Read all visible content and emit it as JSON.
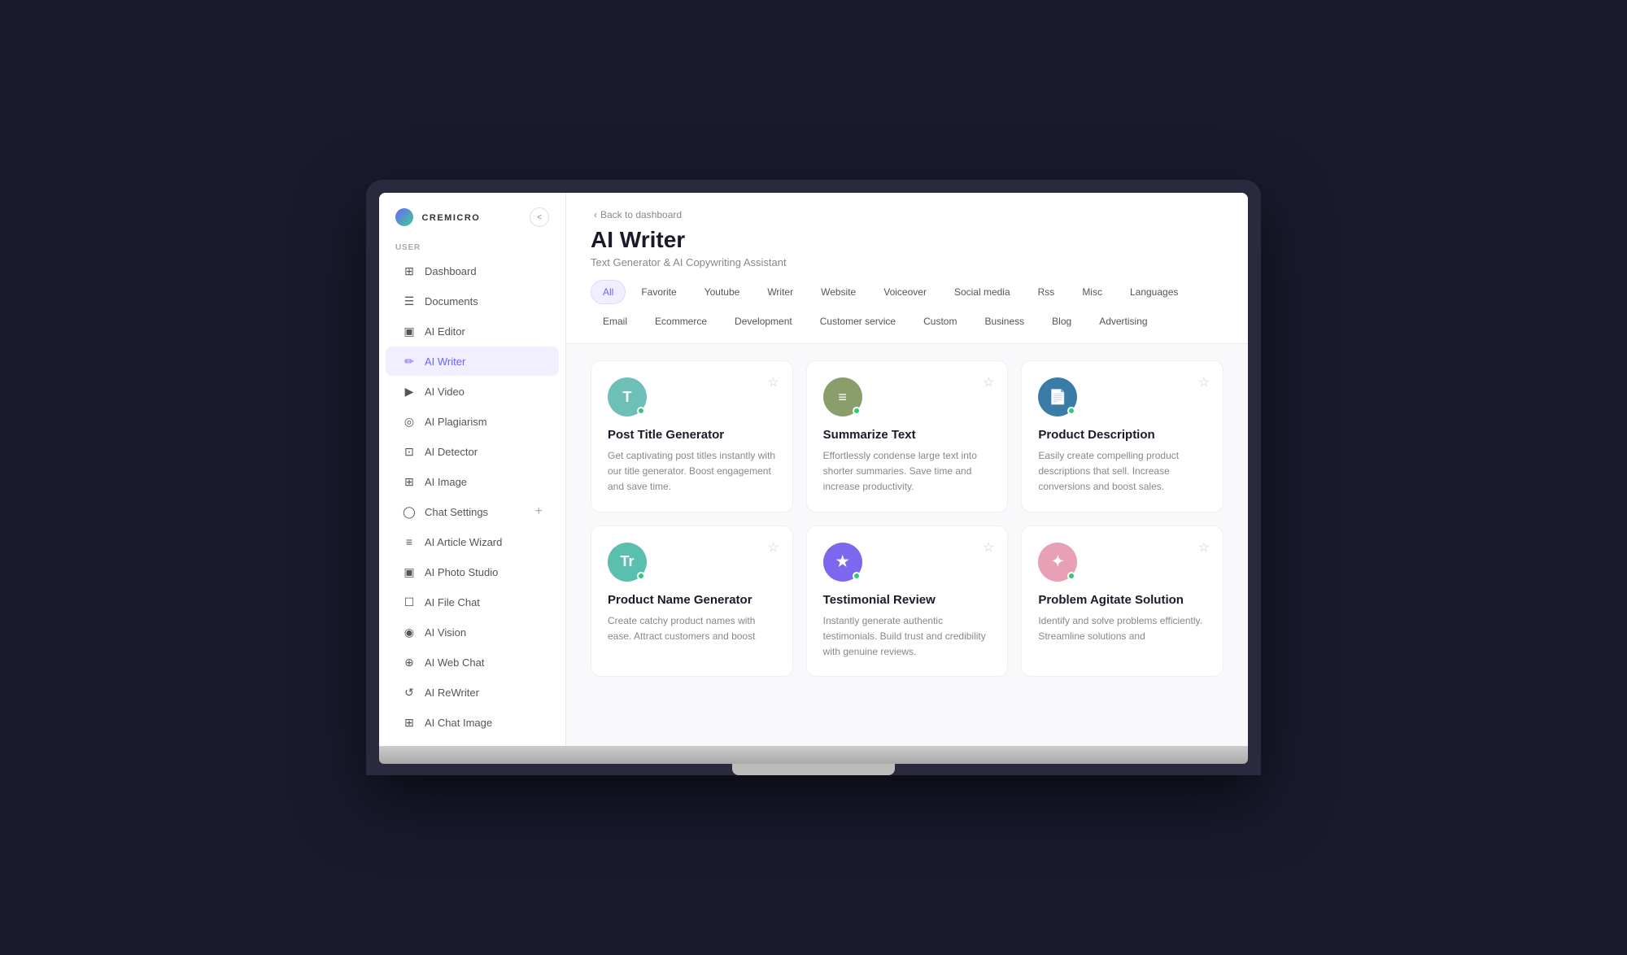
{
  "logo": {
    "text": "CREMICRO",
    "collapse_label": "<"
  },
  "sidebar": {
    "section_label": "USER",
    "items": [
      {
        "id": "dashboard",
        "label": "Dashboard",
        "icon": "⊞",
        "active": false
      },
      {
        "id": "documents",
        "label": "Documents",
        "icon": "☰",
        "active": false
      },
      {
        "id": "ai-editor",
        "label": "AI Editor",
        "icon": "▣",
        "active": false
      },
      {
        "id": "ai-writer",
        "label": "AI Writer",
        "icon": "✏",
        "active": true
      },
      {
        "id": "ai-video",
        "label": "AI Video",
        "icon": "▶",
        "active": false
      },
      {
        "id": "ai-plagiarism",
        "label": "AI Plagiarism",
        "icon": "◎",
        "active": false
      },
      {
        "id": "ai-detector",
        "label": "AI Detector",
        "icon": "⊡",
        "active": false
      },
      {
        "id": "ai-image",
        "label": "AI Image",
        "icon": "⊞",
        "active": false
      },
      {
        "id": "chat-settings",
        "label": "Chat Settings",
        "icon": "◯",
        "active": false,
        "has_plus": true
      },
      {
        "id": "ai-article-wizard",
        "label": "AI Article Wizard",
        "icon": "≡",
        "active": false
      },
      {
        "id": "ai-photo-studio",
        "label": "AI Photo Studio",
        "icon": "▣",
        "active": false
      },
      {
        "id": "ai-file-chat",
        "label": "AI File Chat",
        "icon": "☐",
        "active": false
      },
      {
        "id": "ai-vision",
        "label": "AI Vision",
        "icon": "◉",
        "active": false
      },
      {
        "id": "ai-web-chat",
        "label": "AI Web Chat",
        "icon": "⊕",
        "active": false
      },
      {
        "id": "ai-rewriter",
        "label": "AI ReWriter",
        "icon": "↺",
        "active": false
      },
      {
        "id": "ai-chat-image",
        "label": "AI Chat Image",
        "icon": "⊞",
        "active": false
      }
    ]
  },
  "header": {
    "back_label": "Back to dashboard",
    "title": "AI Writer",
    "subtitle": "Text Generator & AI Copywriting Assistant"
  },
  "tabs_row1": [
    {
      "id": "all",
      "label": "All",
      "active": true
    },
    {
      "id": "favorite",
      "label": "Favorite",
      "active": false
    },
    {
      "id": "youtube",
      "label": "Youtube",
      "active": false
    },
    {
      "id": "writer",
      "label": "Writer",
      "active": false
    },
    {
      "id": "website",
      "label": "Website",
      "active": false
    },
    {
      "id": "voiceover",
      "label": "Voiceover",
      "active": false
    },
    {
      "id": "social-media",
      "label": "Social media",
      "active": false
    },
    {
      "id": "rss",
      "label": "Rss",
      "active": false
    },
    {
      "id": "misc",
      "label": "Misc",
      "active": false
    },
    {
      "id": "languages",
      "label": "Languages",
      "active": false
    }
  ],
  "tabs_row2": [
    {
      "id": "email",
      "label": "Email",
      "active": false
    },
    {
      "id": "ecommerce",
      "label": "Ecommerce",
      "active": false
    },
    {
      "id": "development",
      "label": "Development",
      "active": false
    },
    {
      "id": "customer-service",
      "label": "Customer service",
      "active": false
    },
    {
      "id": "custom",
      "label": "Custom",
      "active": false
    },
    {
      "id": "business",
      "label": "Business",
      "active": false
    },
    {
      "id": "blog",
      "label": "Blog",
      "active": false
    },
    {
      "id": "advertising",
      "label": "Advertising",
      "active": false
    }
  ],
  "cards": [
    {
      "id": "post-title-generator",
      "icon_letter": "T",
      "icon_bg": "bg-teal",
      "title": "Post Title Generator",
      "description": "Get captivating post titles instantly with our title generator. Boost engagement and save time."
    },
    {
      "id": "summarize-text",
      "icon_letter": "≡",
      "icon_bg": "bg-olive",
      "title": "Summarize Text",
      "description": "Effortlessly condense large text into shorter summaries. Save time and increase productivity."
    },
    {
      "id": "product-description",
      "icon_letter": "📄",
      "icon_bg": "bg-blue-dark",
      "title": "Product Description",
      "description": "Easily create compelling product descriptions that sell. Increase conversions and boost sales."
    },
    {
      "id": "product-name-generator",
      "icon_letter": "Tr",
      "icon_bg": "bg-mint",
      "title": "Product Name Generator",
      "description": "Create catchy product names with ease. Attract customers and boost"
    },
    {
      "id": "testimonial-review",
      "icon_letter": "★",
      "icon_bg": "bg-purple",
      "title": "Testimonial Review",
      "description": "Instantly generate authentic testimonials. Build trust and credibility with genuine reviews."
    },
    {
      "id": "problem-agitate-solution",
      "icon_letter": "✦",
      "icon_bg": "bg-pink",
      "title": "Problem Agitate Solution",
      "description": "Identify and solve problems efficiently. Streamline solutions and"
    }
  ]
}
